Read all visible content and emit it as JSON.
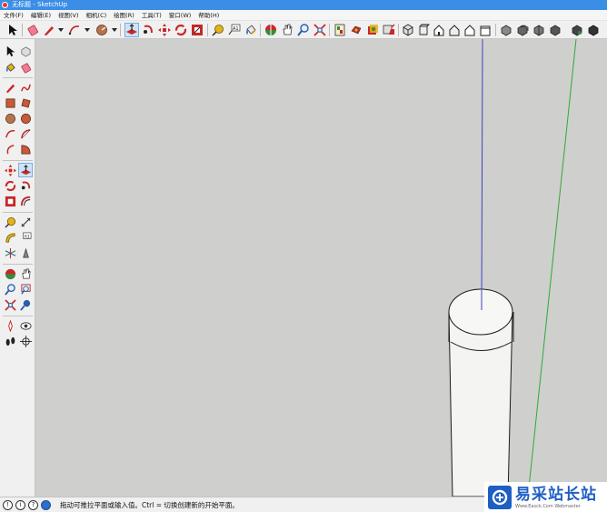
{
  "window": {
    "title": "无标题 - SketchUp"
  },
  "menu": [
    {
      "label": "文件(F)"
    },
    {
      "label": "编辑(E)"
    },
    {
      "label": "视图(V)"
    },
    {
      "label": "相机(C)"
    },
    {
      "label": "绘图(R)"
    },
    {
      "label": "工具(T)"
    },
    {
      "label": "窗口(W)"
    },
    {
      "label": "帮助(H)"
    }
  ],
  "status": {
    "text": "拖动可推拉平面或输入值。Ctrl = 切换创建新的开始平面。",
    "icon_1": "!",
    "icon_2": "i",
    "icon_3": "?"
  },
  "watermark": {
    "text": "易采站长站",
    "subtext": "Www.Easck.Com Webmaster"
  },
  "colors": {
    "title_bar": "#3a8ee6",
    "viewport": "#cfcfcd",
    "blue_axis": "#4040c8",
    "green_axis": "#2eaa3a",
    "active_tool": "#cde3f7"
  },
  "icons": {
    "top_toolbar": [
      "select-icon",
      "eraser-icon",
      "pencil-icon",
      "arc-icon",
      "rotated-rect-icon",
      "push-pull-icon",
      "follow-me-icon",
      "move-icon",
      "rotate-icon",
      "scale-icon",
      "tape-measure-icon",
      "text-icon",
      "paint-bucket-icon",
      "orbit-icon",
      "pan-icon",
      "zoom-icon",
      "zoom-extents-icon",
      "components-icon",
      "materials-icon",
      "styles-icon",
      "warehouse-icon",
      "iso-view-icon",
      "top-view-icon",
      "front-view-icon",
      "right-view-icon",
      "back-view-icon",
      "left-view-icon",
      "xray-icon",
      "wireframe-icon",
      "hidden-line-icon",
      "shaded-icon",
      "shaded-textures-icon",
      "monochrome-icon"
    ],
    "active_tool": "push-pull-icon"
  }
}
